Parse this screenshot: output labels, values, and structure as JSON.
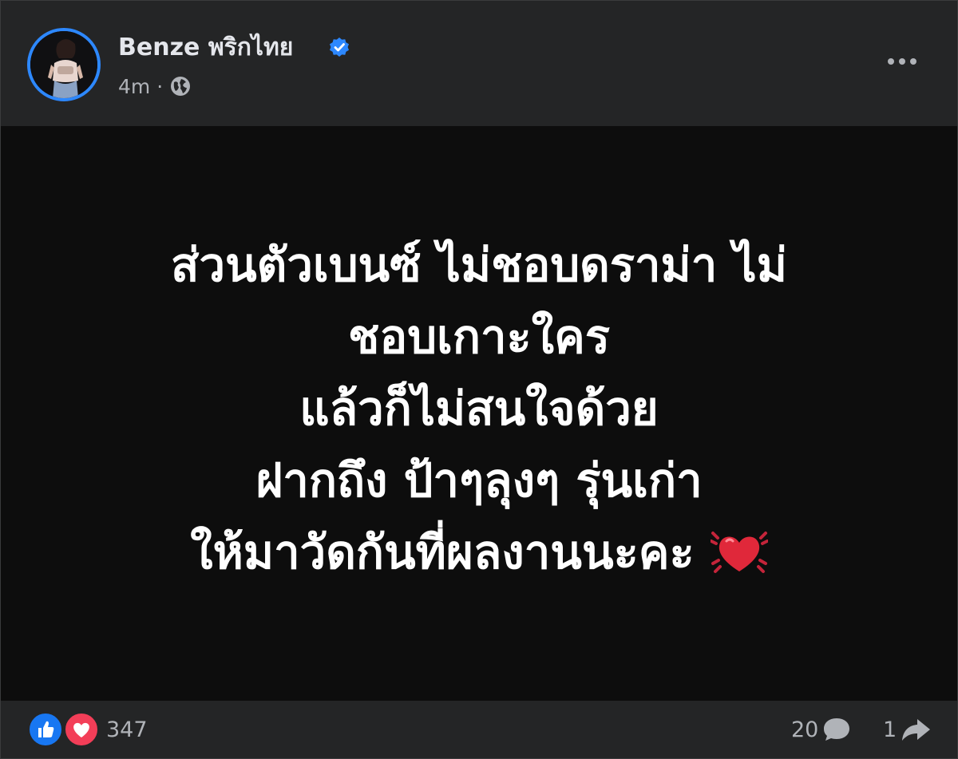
{
  "post": {
    "author_name": "Benze พริกไทย",
    "timestamp": "4m",
    "separator": "·",
    "privacy_icon": "globe-icon",
    "verified_icon": "verified-badge-icon",
    "more_icon": "more-options-icon"
  },
  "content": {
    "background": "#0d0d0d",
    "lines": [
      "ส่วนตัวเบนซ์ ไม่ชอบดราม่า ไม่",
      "ชอบเกาะใคร",
      "แล้วก็ไม่สนใจด้วย",
      "ฝากถึง ป้าๆลุงๆ รุ่นเก่า",
      "ให้มาวัดกันที่ผลงานนะคะ"
    ],
    "emoji_icon": "beating-heart-icon"
  },
  "footer": {
    "reaction_icons": [
      "like-icon",
      "love-icon"
    ],
    "reaction_count": "347",
    "comment_count": "20",
    "share_count": "1"
  },
  "colors": {
    "accent": "#2d88ff",
    "like": "#1877f2",
    "love": "#f33e58",
    "text_secondary": "#b0b3b8",
    "text_primary": "#e4e6eb"
  }
}
